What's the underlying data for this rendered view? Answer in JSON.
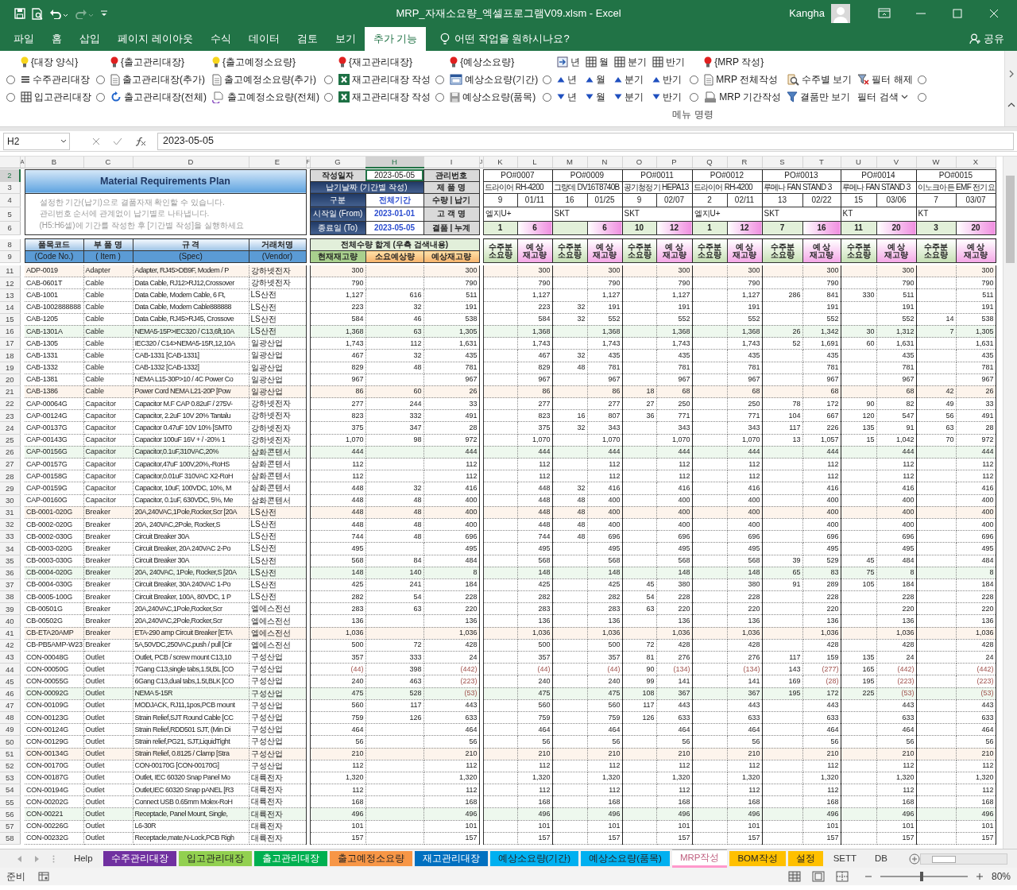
{
  "window": {
    "title": "MRP_자재소요량_엑셀프로그램V09.xlsm - Excel",
    "user": "Kangha"
  },
  "ribbon_tabs": [
    {
      "label": "파일",
      "selected": false
    },
    {
      "label": "홈",
      "selected": false
    },
    {
      "label": "삽입",
      "selected": false
    },
    {
      "label": "페이지 레이아웃",
      "selected": false
    },
    {
      "label": "수식",
      "selected": false
    },
    {
      "label": "데이터",
      "selected": false
    },
    {
      "label": "검토",
      "selected": false
    },
    {
      "label": "보기",
      "selected": false
    },
    {
      "label": "추가 기능",
      "selected": true
    }
  ],
  "tell_me": "어떤 작업을 원하시나요?",
  "share": "공유",
  "ribbon": {
    "columns": [
      {
        "items": [
          {
            "kind": "bulb",
            "label": "{대장 양식}",
            "color": "#f7d51d"
          },
          {
            "kind": "list",
            "label": "수주관리대장",
            "checked": false
          },
          {
            "kind": "grid",
            "label": "입고관리대장",
            "checked": false
          }
        ]
      },
      {
        "items": [
          {
            "kind": "bulb",
            "label": "{출고관리대장}",
            "color": "#e02020"
          },
          {
            "kind": "doc",
            "label": "출고관리대장(추가)",
            "checked": false
          },
          {
            "kind": "refresh",
            "label": "출고관리대장(전체)",
            "checked": false
          }
        ]
      },
      {
        "items": [
          {
            "kind": "bulb",
            "label": "{출고예정소요량}",
            "color": "#f7d51d"
          },
          {
            "kind": "doc",
            "label": "출고예정소요량(추가)"
          },
          {
            "kind": "cycle",
            "label": "출고예정소요량(전체)"
          }
        ]
      },
      {
        "items": [
          {
            "kind": "bulb",
            "label": "{재고관리대장}",
            "color": "#e02020"
          },
          {
            "kind": "excel",
            "label": "재고관리대장 작성",
            "checked": false
          },
          {
            "kind": "excel",
            "label": "재고관리대장 작성",
            "checked": false
          }
        ]
      },
      {
        "items": [
          {
            "kind": "bulb",
            "label": "{예상소요량}",
            "color": "#e02020"
          },
          {
            "kind": "window",
            "label": "예상소요량(기간)",
            "checked": false
          },
          {
            "kind": "disk",
            "label": "예상소요량(품목)",
            "checked": false
          }
        ]
      },
      {
        "items": [
          {
            "kind": "period",
            "label": "년"
          },
          {
            "kind": "up",
            "label": "년",
            "checked": false
          },
          {
            "kind": "down",
            "label": "년",
            "checked": false
          }
        ]
      },
      {
        "items": [
          {
            "kind": "grid",
            "label": "월"
          },
          {
            "kind": "up",
            "label": "월"
          },
          {
            "kind": "down",
            "label": "월"
          }
        ]
      },
      {
        "items": [
          {
            "kind": "grid",
            "label": "분기"
          },
          {
            "kind": "up",
            "label": "분기"
          },
          {
            "kind": "down",
            "label": "분기"
          }
        ]
      },
      {
        "items": [
          {
            "kind": "grid",
            "label": "반기"
          },
          {
            "kind": "up",
            "label": "반기"
          },
          {
            "kind": "down",
            "label": "반기"
          }
        ]
      },
      {
        "items": [
          {
            "kind": "bulb",
            "label": "{MRP 작성}",
            "color": "#e02020"
          },
          {
            "kind": "doc",
            "label": "MRP 전체작성",
            "checked": false
          },
          {
            "kind": "print",
            "label": "MRP 기간작성",
            "checked": false
          }
        ]
      },
      {
        "items": [
          {
            "kind": "search",
            "label": "수주별 보기"
          },
          {
            "kind": "filter",
            "label": "결품만 보기"
          }
        ]
      },
      {
        "items": [
          {
            "kind": "clear",
            "label": "필터 해제"
          },
          {
            "kind": "dropdown",
            "label": "필터 검색"
          }
        ]
      },
      {
        "items": [
          {
            "kind": "radio",
            "checked": false
          },
          {
            "kind": "radio",
            "checked": false
          }
        ]
      }
    ],
    "group_label": "메뉴 명령"
  },
  "formula_bar": {
    "name_box": "H2",
    "value": "2023-05-05"
  },
  "column_headers": [
    {
      "label": "A",
      "selected": false
    },
    {
      "label": "B",
      "selected": false
    },
    {
      "label": "C",
      "selected": false
    },
    {
      "label": "D",
      "selected": false
    },
    {
      "label": "E",
      "selected": false
    },
    {
      "label": "F",
      "selected": false
    },
    {
      "label": "G",
      "selected": false
    },
    {
      "label": "H",
      "selected": true
    },
    {
      "label": "I",
      "selected": false
    },
    {
      "label": "J",
      "selected": false
    },
    {
      "label": "K",
      "selected": false
    },
    {
      "label": "L",
      "selected": false
    },
    {
      "label": "M",
      "selected": false
    },
    {
      "label": "N",
      "selected": false
    },
    {
      "label": "O",
      "selected": false
    },
    {
      "label": "P",
      "selected": false
    },
    {
      "label": "Q",
      "selected": false
    },
    {
      "label": "R",
      "selected": false
    },
    {
      "label": "S",
      "selected": false
    },
    {
      "label": "T",
      "selected": false
    },
    {
      "label": "U",
      "selected": false
    },
    {
      "label": "V",
      "selected": false
    },
    {
      "label": "W",
      "selected": false
    },
    {
      "label": "X",
      "selected": false
    }
  ],
  "header_rows": [
    {
      "label": "2",
      "selected": true
    },
    {
      "label": "3",
      "selected": false
    },
    {
      "label": "4",
      "selected": false
    },
    {
      "label": "5",
      "selected": false
    },
    {
      "label": "6",
      "selected": false
    },
    {
      "label": "8",
      "selected": false
    },
    {
      "label": "9",
      "selected": false
    }
  ],
  "plan": {
    "title": "Material Requirements Plan",
    "notes": [
      "설정한 기간(납기)으로 결품자재 확인할 수 있습니다.",
      "관리번호 순서에 관계없이 납기별로 나타냅니다.",
      "(H5:H6셀)에 기간를 작성한 후 [기간별 작성]을 실행하세요"
    ]
  },
  "date_panel": {
    "created": {
      "label": "작성일자",
      "value": "2023-05-05",
      "selected": true
    },
    "period_title": "납기날짜 (기간별 작성)",
    "fields": [
      {
        "label": "구분",
        "value": "전체기간"
      },
      {
        "label": "시작일 (From)",
        "value": "2023-01-01"
      },
      {
        "label": "종료일 (To)",
        "value": "2023-05-05"
      }
    ]
  },
  "order_labels": [
    "관리번호",
    "제 품 명",
    "수량 | 납기",
    "고 객 명",
    "결품 | 누계"
  ],
  "orders": [
    {
      "po": "PO#0007",
      "product": "드라이어 RH-4200",
      "qty": "9",
      "due": "01/11",
      "customer": "엘지U+",
      "shortage": "1",
      "cumulative": "6",
      "need_title": "수주분\n소요량",
      "stock_title": "예 상\n재고량"
    },
    {
      "po": "PO#0009",
      "product": "그랑데 DV16T8740B",
      "qty": "16",
      "due": "01/25",
      "customer": "SKT",
      "cumulative": "6",
      "need_title": "수주분\n소요량",
      "stock_title": "예 상\n재고량"
    },
    {
      "po": "PO#0011",
      "product": "공기청정기 HEPA13",
      "qty": "9",
      "due": "02/07",
      "customer": "SKT",
      "shortage": "10",
      "cumulative": "12",
      "need_title": "수주분\n소요량",
      "stock_title": "예 상\n재고량"
    },
    {
      "po": "PO#0012",
      "product": "드라이어 RH-4200",
      "qty": "2",
      "due": "02/11",
      "customer": "엘지U+",
      "shortage": "1",
      "cumulative": "12",
      "need_title": "수주분\n소요량",
      "stock_title": "예 상\n재고량"
    },
    {
      "po": "PO#0013",
      "product": "루메나 FAN STAND 3",
      "qty": "13",
      "due": "02/22",
      "customer": "SKT",
      "shortage": "7",
      "cumulative": "16",
      "need_title": "수주분\n소요량",
      "stock_title": "예 상\n재고량"
    },
    {
      "po": "PO#0014",
      "product": "루메나 FAN STAND 3",
      "qty": "15",
      "due": "03/06",
      "customer": "KT",
      "shortage": "11",
      "cumulative": "20",
      "need_title": "수주분\n소요량",
      "stock_title": "예 상\n재고량"
    },
    {
      "po": "PO#0015",
      "product": "이노크아든 EMF 전기요",
      "qty": "7",
      "due": "03/07",
      "customer": "KT",
      "shortage": "3",
      "cumulative": "20",
      "need_title": "수주분\n소요량",
      "stock_title": "예 상\n재고량"
    }
  ],
  "item_columns": [
    {
      "title": "품목코드",
      "sub": "(Code No.)"
    },
    {
      "title": "부 품 명",
      "sub": "( Item )"
    },
    {
      "title": "규 격",
      "sub": "(Spec)"
    },
    {
      "title": "거래처명",
      "sub": "(Vendor)"
    }
  ],
  "total_header": "전체수량 합계 (우측 검색내용)",
  "total_columns": [
    "현재재고량",
    "소요예상량",
    "예상재고량"
  ],
  "rows": [
    {
      "row": "11",
      "cells": [
        "ADP-0019",
        "Adapter",
        "Adapter, RJ45>DB9F, Modem / P",
        "강하넷전자",
        "300",
        null,
        "300",
        null,
        "300",
        null,
        "300",
        null,
        "300",
        null,
        "300",
        null,
        "300",
        null,
        "300",
        null,
        "300"
      ]
    },
    {
      "row": "12",
      "cells": [
        "CAB-0601T",
        "Cable",
        "Data Cable, RJ12>RJ12,Crossover",
        "강하넷전자",
        "790",
        null,
        "790",
        null,
        "790",
        null,
        "790",
        null,
        "790",
        null,
        "790",
        null,
        "790",
        null,
        "790",
        null,
        "790"
      ]
    },
    {
      "row": "13",
      "cells": [
        "CAB-1001",
        "Cable",
        "Data Cable, Modem Cable, 6 Ft,",
        "LS산전",
        "1,127",
        "616",
        "511",
        null,
        "1,127",
        null,
        "1,127",
        null,
        "1,127",
        null,
        "1,127",
        "286",
        "841",
        "330",
        "511",
        null,
        "511"
      ]
    },
    {
      "row": "14",
      "cells": [
        "CAB-1002888888",
        "Cable",
        "Data Cable, Modem Cable888888",
        "LS산전",
        "223",
        "32",
        "191",
        null,
        "223",
        "32",
        "191",
        null,
        "191",
        null,
        "191",
        null,
        "191",
        null,
        "191",
        null,
        "191"
      ]
    },
    {
      "row": "15",
      "cells": [
        "CAB-1205",
        "Cable",
        "Data Cable, RJ45>RJ45, Crossove",
        "LS산전",
        "584",
        "46",
        "538",
        null,
        "584",
        "32",
        "552",
        null,
        "552",
        null,
        "552",
        null,
        "552",
        null,
        "552",
        "14",
        "538"
      ]
    },
    {
      "row": "16",
      "cells": [
        "CAB-1301A",
        "Cable",
        "NEMA5-15P>IEC320 / C13,6ft,10A",
        "LS산전",
        "1,368",
        "63",
        "1,305",
        null,
        "1,368",
        null,
        "1,368",
        null,
        "1,368",
        null,
        "1,368",
        "26",
        "1,342",
        "30",
        "1,312",
        "7",
        "1,305"
      ]
    },
    {
      "row": "17",
      "cells": [
        "CAB-1305",
        "Cable",
        "IEC320 / C14>NEMA5-15R,12,10A",
        "일광산업",
        "1,743",
        "112",
        "1,631",
        null,
        "1,743",
        null,
        "1,743",
        null,
        "1,743",
        null,
        "1,743",
        "52",
        "1,691",
        "60",
        "1,631",
        null,
        "1,631"
      ]
    },
    {
      "row": "18",
      "cells": [
        "CAB-1331",
        "Cable",
        "CAB-1331 [CAB-1331]",
        "일광산업",
        "467",
        "32",
        "435",
        null,
        "467",
        "32",
        "435",
        null,
        "435",
        null,
        "435",
        null,
        "435",
        null,
        "435",
        null,
        "435"
      ]
    },
    {
      "row": "19",
      "cells": [
        "CAB-1332",
        "Cable",
        "CAB-1332 [CAB-1332]",
        "일광산업",
        "829",
        "48",
        "781",
        null,
        "829",
        "48",
        "781",
        null,
        "781",
        null,
        "781",
        null,
        "781",
        null,
        "781",
        null,
        "781"
      ]
    },
    {
      "row": "20",
      "cells": [
        "CAB-1381",
        "Cable",
        "NEMA L15-30P>10 / 4C Power Co",
        "일광산업",
        "967",
        null,
        "967",
        null,
        "967",
        null,
        "967",
        null,
        "967",
        null,
        "967",
        null,
        "967",
        null,
        "967",
        null,
        "967"
      ]
    },
    {
      "row": "21",
      "cells": [
        "CAB-1386",
        "Cable",
        "Power Cord NEMA L21-20P [Pow",
        "일광산업",
        "86",
        "60",
        "26",
        null,
        "86",
        null,
        "86",
        "18",
        "68",
        null,
        "68",
        null,
        "68",
        null,
        "68",
        "42",
        "26"
      ]
    },
    {
      "row": "22",
      "cells": [
        "CAP-00064G",
        "Capacitor",
        "Capacitor M.F CAP 0.82uF / 275V-",
        "강하넷전자",
        "277",
        "244",
        "33",
        null,
        "277",
        null,
        "277",
        "27",
        "250",
        null,
        "250",
        "78",
        "172",
        "90",
        "82",
        "49",
        "33"
      ]
    },
    {
      "row": "23",
      "cells": [
        "CAP-00124G",
        "Capacitor",
        "Capacitor, 2.2uF 10V 20% Tantalu",
        "강하넷전자",
        "823",
        "332",
        "491",
        null,
        "823",
        "16",
        "807",
        "36",
        "771",
        null,
        "771",
        "104",
        "667",
        "120",
        "547",
        "56",
        "491"
      ]
    },
    {
      "row": "24",
      "cells": [
        "CAP-00137G",
        "Capacitor",
        "Capacitor 0.47uF 10V 10% [SMT0",
        "강하넷전자",
        "375",
        "347",
        "28",
        null,
        "375",
        "32",
        "343",
        null,
        "343",
        null,
        "343",
        "117",
        "226",
        "135",
        "91",
        "63",
        "28"
      ]
    },
    {
      "row": "25",
      "cells": [
        "CAP-00143G",
        "Capacitor",
        "Capacitor 100uF 16V + / -20% 1",
        "강하넷전자",
        "1,070",
        "98",
        "972",
        null,
        "1,070",
        null,
        "1,070",
        null,
        "1,070",
        null,
        "1,070",
        "13",
        "1,057",
        "15",
        "1,042",
        "70",
        "972"
      ]
    },
    {
      "row": "26",
      "cells": [
        "CAP-00156G",
        "Capacitor",
        "Capacitor,0.1uF,310VAC,20%",
        "삼화콘텐서",
        "444",
        null,
        "444",
        null,
        "444",
        null,
        "444",
        null,
        "444",
        null,
        "444",
        null,
        "444",
        null,
        "444",
        null,
        "444"
      ]
    },
    {
      "row": "27",
      "cells": [
        "CAP-00157G",
        "Capacitor",
        "Capacitor,47uF 100V,20%,-RoHS",
        "삼화콘텐서",
        "112",
        null,
        "112",
        null,
        "112",
        null,
        "112",
        null,
        "112",
        null,
        "112",
        null,
        "112",
        null,
        "112",
        null,
        "112"
      ]
    },
    {
      "row": "28",
      "cells": [
        "CAP-00158G",
        "Capacitor",
        "Capacitor,0.01uF 310VAC X2-RoH",
        "삼화콘텐서",
        "112",
        null,
        "112",
        null,
        "112",
        null,
        "112",
        null,
        "112",
        null,
        "112",
        null,
        "112",
        null,
        "112",
        null,
        "112"
      ]
    },
    {
      "row": "29",
      "cells": [
        "CAP-00159G",
        "Capacitor",
        "Capacitor, 10uF, 100VDC, 10%, M",
        "삼화콘텐서",
        "448",
        "32",
        "416",
        null,
        "448",
        "32",
        "416",
        null,
        "416",
        null,
        "416",
        null,
        "416",
        null,
        "416",
        null,
        "416"
      ]
    },
    {
      "row": "30",
      "cells": [
        "CAP-00160G",
        "Capacitor",
        "Capacitor, 0.1uF, 630VDC, 5%, Me",
        "삼화콘텐서",
        "448",
        "48",
        "400",
        null,
        "448",
        "48",
        "400",
        null,
        "400",
        null,
        "400",
        null,
        "400",
        null,
        "400",
        null,
        "400"
      ]
    },
    {
      "row": "31",
      "cells": [
        "CB-0001-020G",
        "Breaker",
        "20A,240VAC,1Pole,Rocker,Scr [20A",
        "LS산전",
        "448",
        "48",
        "400",
        null,
        "448",
        "48",
        "400",
        null,
        "400",
        null,
        "400",
        null,
        "400",
        null,
        "400",
        null,
        "400"
      ]
    },
    {
      "row": "32",
      "cells": [
        "CB-0002-020G",
        "Breaker",
        "20A, 240VAC,2Pole, Rocker,S",
        "LS산전",
        "448",
        "48",
        "400",
        null,
        "448",
        "48",
        "400",
        null,
        "400",
        null,
        "400",
        null,
        "400",
        null,
        "400",
        null,
        "400"
      ]
    },
    {
      "row": "33",
      "cells": [
        "CB-0002-030G",
        "Breaker",
        "Circuit Breaker 30A",
        "LS산전",
        "744",
        "48",
        "696",
        null,
        "744",
        "48",
        "696",
        null,
        "696",
        null,
        "696",
        null,
        "696",
        null,
        "696",
        null,
        "696"
      ]
    },
    {
      "row": "34",
      "cells": [
        "CB-0003-020G",
        "Breaker",
        "Circuit Breaker, 20A 240VAC 2-Po",
        "LS산전",
        "495",
        null,
        "495",
        null,
        "495",
        null,
        "495",
        null,
        "495",
        null,
        "495",
        null,
        "495",
        null,
        "495",
        null,
        "495"
      ]
    },
    {
      "row": "35",
      "cells": [
        "CB-0003-030G",
        "Breaker",
        "Circuit Breaker 30A",
        "LS산전",
        "568",
        "84",
        "484",
        null,
        "568",
        null,
        "568",
        null,
        "568",
        null,
        "568",
        "39",
        "529",
        "45",
        "484",
        null,
        "484"
      ]
    },
    {
      "row": "36",
      "cells": [
        "CB-0004-020G",
        "Breaker",
        "20A, 240VAC, 1Pole, Rocker,S [20A",
        "LS산전",
        "148",
        "140",
        "8",
        null,
        "148",
        null,
        "148",
        null,
        "148",
        null,
        "148",
        "65",
        "83",
        "75",
        "8",
        null,
        "8"
      ]
    },
    {
      "row": "37",
      "cells": [
        "CB-0004-030G",
        "Breaker",
        "Circuit Breaker, 30A 240VAC 1-Po",
        "LS산전",
        "425",
        "241",
        "184",
        null,
        "425",
        null,
        "425",
        "45",
        "380",
        null,
        "380",
        "91",
        "289",
        "105",
        "184",
        null,
        "184"
      ]
    },
    {
      "row": "38",
      "cells": [
        "CB-0005-100G",
        "Breaker",
        "Circuit Breaker, 100A, 80VDC, 1 P",
        "LS산전",
        "282",
        "54",
        "228",
        null,
        "282",
        null,
        "282",
        "54",
        "228",
        null,
        "228",
        null,
        "228",
        null,
        "228",
        null,
        "228"
      ]
    },
    {
      "row": "39",
      "cells": [
        "CB-00501G",
        "Breaker",
        "20A,240VAC,1Pole,Rocker,Scr",
        "엘에스전선",
        "283",
        "63",
        "220",
        null,
        "283",
        null,
        "283",
        "63",
        "220",
        null,
        "220",
        null,
        "220",
        null,
        "220",
        null,
        "220"
      ]
    },
    {
      "row": "40",
      "cells": [
        "CB-00502G",
        "Breaker",
        "20A,240VAC,2Pole,Rocker,Scr",
        "엘에스전선",
        "136",
        null,
        "136",
        null,
        "136",
        null,
        "136",
        null,
        "136",
        null,
        "136",
        null,
        "136",
        null,
        "136",
        null,
        "136"
      ]
    },
    {
      "row": "41",
      "cells": [
        "CB-ETA20AMP",
        "Breaker",
        "ETA-290 amp Circuit Breaker [ETA",
        "엘에스전선",
        "1,036",
        null,
        "1,036",
        null,
        "1,036",
        null,
        "1,036",
        null,
        "1,036",
        null,
        "1,036",
        null,
        "1,036",
        null,
        "1,036",
        null,
        "1,036"
      ]
    },
    {
      "row": "42",
      "cells": [
        "CB-PB5AMP-W23",
        "Breaker",
        "5A,50VDC,250VAC,push / pull [Cir",
        "엘에스전선",
        "500",
        "72",
        "428",
        null,
        "500",
        null,
        "500",
        "72",
        "428",
        null,
        "428",
        null,
        "428",
        null,
        "428",
        null,
        "428"
      ]
    },
    {
      "row": "43",
      "cells": [
        "CON-00048G",
        "Outlet",
        "Outlet, PCB / screw mount C13,10",
        "구성산업",
        "357",
        "333",
        "24",
        null,
        "357",
        null,
        "357",
        "81",
        "276",
        null,
        "276",
        "117",
        "159",
        "135",
        "24",
        null,
        "24"
      ]
    },
    {
      "row": "44",
      "cells": [
        "CON-00050G",
        "Outlet",
        "7Gang C13,single tabs,1.5t,BL [CO",
        "구성산업",
        {
          "text": "(44)",
          "negative": true
        },
        "398",
        {
          "text": "(442)",
          "negative": true
        },
        null,
        {
          "text": "(44)",
          "negative": true
        },
        null,
        {
          "text": "(44)",
          "negative": true
        },
        "90",
        {
          "text": "(134)",
          "negative": true
        },
        null,
        {
          "text": "(134)",
          "negative": true
        },
        "143",
        {
          "text": "(277)",
          "negative": true
        },
        "165",
        {
          "text": "(442)",
          "negative": true
        },
        null,
        {
          "text": "(442)",
          "negative": true
        }
      ]
    },
    {
      "row": "45",
      "cells": [
        "CON-00055G",
        "Outlet",
        "6Gang C13,dual tabs,1.5t,BLK [CO",
        "구성산업",
        "240",
        "463",
        {
          "text": "(223)",
          "negative": true
        },
        null,
        "240",
        null,
        "240",
        "99",
        "141",
        null,
        "141",
        "169",
        {
          "text": "(28)",
          "negative": true
        },
        "195",
        {
          "text": "(223)",
          "negative": true
        },
        null,
        {
          "text": "(223)",
          "negative": true
        }
      ]
    },
    {
      "row": "46",
      "cells": [
        "CON-00092G",
        "Outlet",
        "NEMA 5-15R",
        "구성산업",
        "475",
        "528",
        {
          "text": "(53)",
          "negative": true
        },
        null,
        "475",
        null,
        "475",
        "108",
        "367",
        null,
        "367",
        "195",
        "172",
        "225",
        {
          "text": "(53)",
          "negative": true
        },
        null,
        {
          "text": "(53)",
          "negative": true
        }
      ]
    },
    {
      "row": "47",
      "cells": [
        "CON-00109G",
        "Outlet",
        "MODJACK, RJ11,1pos,PCB mount",
        "구성산업",
        "560",
        "117",
        "443",
        null,
        "560",
        null,
        "560",
        "117",
        "443",
        null,
        "443",
        null,
        "443",
        null,
        "443",
        null,
        "443"
      ]
    },
    {
      "row": "48",
      "cells": [
        "CON-00123G",
        "Outlet",
        "Strain Relief,SJT Round Cable [CC",
        "구성산업",
        "759",
        "126",
        "633",
        null,
        "759",
        null,
        "759",
        "126",
        "633",
        null,
        "633",
        null,
        "633",
        null,
        "633",
        null,
        "633"
      ]
    },
    {
      "row": "49",
      "cells": [
        "CON-00124G",
        "Outlet",
        "Strain Relief,RDD501 SJT, (Min Di",
        "구성산업",
        "464",
        null,
        "464",
        null,
        "464",
        null,
        "464",
        null,
        "464",
        null,
        "464",
        null,
        "464",
        null,
        "464",
        null,
        "464"
      ]
    },
    {
      "row": "50",
      "cells": [
        "CON-00129G",
        "Outlet",
        "Strain relief,PG21, SJT,LiquidTight",
        "구성산업",
        "56",
        null,
        "56",
        null,
        "56",
        null,
        "56",
        null,
        "56",
        null,
        "56",
        null,
        "56",
        null,
        "56",
        null,
        "56"
      ]
    },
    {
      "row": "51",
      "cells": [
        "CON-00134G",
        "Outlet",
        "Strain Relief, 0.8125 / Clamp [Stra",
        "구성산업",
        "210",
        null,
        "210",
        null,
        "210",
        null,
        "210",
        null,
        "210",
        null,
        "210",
        null,
        "210",
        null,
        "210",
        null,
        "210"
      ]
    },
    {
      "row": "52",
      "cells": [
        "CON-00170G",
        "Outlet",
        "CON-00170G [CON-00170G]",
        "구성산업",
        "112",
        null,
        "112",
        null,
        "112",
        null,
        "112",
        null,
        "112",
        null,
        "112",
        null,
        "112",
        null,
        "112",
        null,
        "112"
      ]
    },
    {
      "row": "53",
      "cells": [
        "CON-00187G",
        "Outlet",
        "Outlet, IEC 60320 Snap Panel Mo",
        "대륙전자",
        "1,320",
        null,
        "1,320",
        null,
        "1,320",
        null,
        "1,320",
        null,
        "1,320",
        null,
        "1,320",
        null,
        "1,320",
        null,
        "1,320",
        null,
        "1,320"
      ]
    },
    {
      "row": "54",
      "cells": [
        "CON-00194G",
        "Outlet",
        "Outlet,IEC 60320 Snap pANEL [R3",
        "대륙전자",
        "112",
        null,
        "112",
        null,
        "112",
        null,
        "112",
        null,
        "112",
        null,
        "112",
        null,
        "112",
        null,
        "112",
        null,
        "112"
      ]
    },
    {
      "row": "55",
      "cells": [
        "CON-00202G",
        "Outlet",
        "Connect USB 0.65mm Molex-RoH",
        "대륙전자",
        "168",
        null,
        "168",
        null,
        "168",
        null,
        "168",
        null,
        "168",
        null,
        "168",
        null,
        "168",
        null,
        "168",
        null,
        "168"
      ]
    },
    {
      "row": "56",
      "cells": [
        "CON-00221",
        "Outlet",
        "Receptacle, Panel Mount, Single,",
        "대륙전자",
        "496",
        null,
        "496",
        null,
        "496",
        null,
        "496",
        null,
        "496",
        null,
        "496",
        null,
        "496",
        null,
        "496",
        null,
        "496"
      ]
    },
    {
      "row": "57",
      "cells": [
        "CON-00226G",
        "Outlet",
        "L6-30R",
        "대륙전자",
        "101",
        null,
        "101",
        null,
        "101",
        null,
        "101",
        null,
        "101",
        null,
        "101",
        null,
        "101",
        null,
        "101",
        null,
        "101"
      ]
    },
    {
      "row": "58",
      "cells": [
        "CON-00232G",
        "Outlet",
        "Receptacle,mate,N-Lock,PCB Righ",
        "대륙전자",
        "157",
        null,
        "157",
        null,
        "157",
        null,
        "157",
        null,
        "157",
        null,
        "157",
        null,
        "157",
        null,
        "157",
        null,
        "157"
      ]
    }
  ],
  "sheet_tabs": [
    {
      "label": "Help",
      "selected": false
    },
    {
      "label": "수주관리대장",
      "color": "#7030a0",
      "selected": false
    },
    {
      "label": "입고관리대장",
      "color": "#92d050",
      "selected": false
    },
    {
      "label": "출고관리대장",
      "color": "#00b050",
      "selected": false
    },
    {
      "label": "출고예정소요량",
      "color": "#f79646",
      "selected": false
    },
    {
      "label": "재고관리대장",
      "color": "#0070c0",
      "selected": false
    },
    {
      "label": "예상소요량(기간)",
      "color": "#00b0f0",
      "selected": false
    },
    {
      "label": "예상소요량(품목)",
      "color": "#00b0f0",
      "selected": false
    },
    {
      "label": "MRP작성",
      "color": "#ff99cc",
      "selected": true
    },
    {
      "label": "BOM작성",
      "color": "#ffc000",
      "selected": false
    },
    {
      "label": "설정",
      "color": "#ffc000",
      "selected": false
    },
    {
      "label": "SETT",
      "selected": false
    },
    {
      "label": "DB",
      "selected": false
    }
  ],
  "status_bar": {
    "status": "준비",
    "zoom": "80%",
    "level": 0.47
  }
}
